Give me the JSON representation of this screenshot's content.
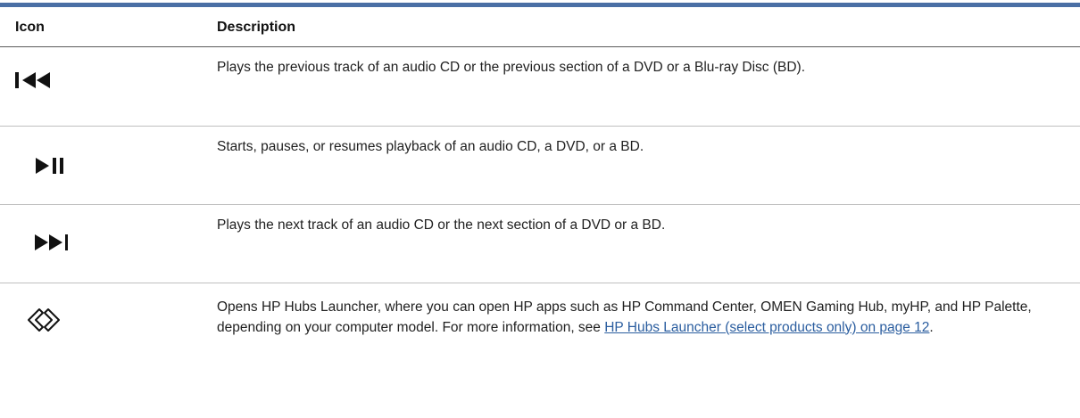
{
  "table": {
    "headers": {
      "icon": "Icon",
      "description": "Description"
    },
    "rows": [
      {
        "icon_name": "previous-track-icon",
        "description": "Plays the previous track of an audio CD or the previous section of a DVD or a Blu-ray Disc (BD)."
      },
      {
        "icon_name": "play-pause-icon",
        "description": "Starts, pauses, or resumes playback of an audio CD, a DVD, or a BD."
      },
      {
        "icon_name": "next-track-icon",
        "description": "Plays the next track of an audio CD or the next section of a DVD or a BD."
      },
      {
        "icon_name": "hp-hubs-launcher-icon",
        "description_before_link": "Opens HP Hubs Launcher, where you can open HP apps such as HP Command Center, OMEN Gaming Hub, myHP, and HP Palette, depending on your computer model. For more information, see ",
        "link_text": "HP Hubs Launcher (select products only) on page 12",
        "description_after_link": "."
      }
    ]
  },
  "colors": {
    "top_rule": "#4a6fa5",
    "link": "#2a5d9f",
    "icon": "#111111"
  }
}
